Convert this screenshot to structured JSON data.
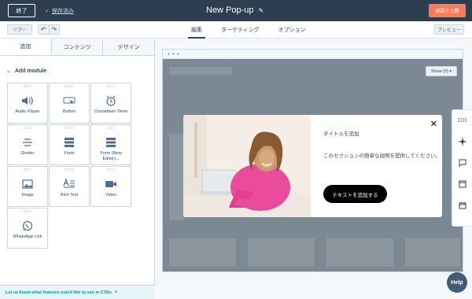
{
  "topbar": {
    "exit_label": "終了",
    "saved_icon": "check-icon",
    "saved_label": "保存済み",
    "title": "New Pop-up",
    "edit_icon": "pencil-icon",
    "publish_label": "確認と公開",
    "accent": "#ff7a59",
    "bg": "#2d3e50"
  },
  "subbar": {
    "tour_label": "ツアー",
    "undo_icon": "undo-icon",
    "redo_icon": "redo-icon",
    "tabs": [
      {
        "label": "編集",
        "active": true
      },
      {
        "label": "ターゲティング",
        "active": false
      },
      {
        "label": "オプション",
        "active": false
      }
    ],
    "preview_label": "プレビュー"
  },
  "left_panel": {
    "tabs": [
      {
        "label": "追加",
        "active": true
      },
      {
        "label": "コンテンツ",
        "active": false
      },
      {
        "label": "デザイン",
        "active": false
      }
    ],
    "section_title": "Add module",
    "modules": [
      {
        "label": "Audio Player",
        "icon": "speaker-icon"
      },
      {
        "label": "Button",
        "icon": "button-icon"
      },
      {
        "label": "Countdown Timer",
        "icon": "alarm-clock-icon"
      },
      {
        "label": "Divider",
        "icon": "divider-icon"
      },
      {
        "label": "Form",
        "icon": "form-icon"
      },
      {
        "label": "Form (New Editor)...",
        "icon": "form-icon"
      },
      {
        "label": "Image",
        "icon": "image-icon"
      },
      {
        "label": "Rich Text",
        "icon": "rich-text-icon"
      },
      {
        "label": "Video",
        "icon": "video-camera-icon"
      },
      {
        "label": "WhatsApp Link",
        "icon": "whatsapp-icon"
      }
    ],
    "feedback_text": "Let us know what features you'd like to see in CTAs",
    "feedback_icon": "external-link-icon"
  },
  "canvas": {
    "show_dropdown": "Show (0) ▾",
    "popup": {
      "title": "タイトルを追加",
      "description": "このセクションの簡単な説明を提供してください。",
      "cta_label": "テキストを追加する",
      "close_icon": "close-icon"
    }
  },
  "right_toolbar": {
    "icons": [
      "grid-dots-icon",
      "sparkle-icon",
      "comment-icon",
      "browser-window-icon",
      "calendar-icon"
    ]
  },
  "help": {
    "label": "Help"
  }
}
